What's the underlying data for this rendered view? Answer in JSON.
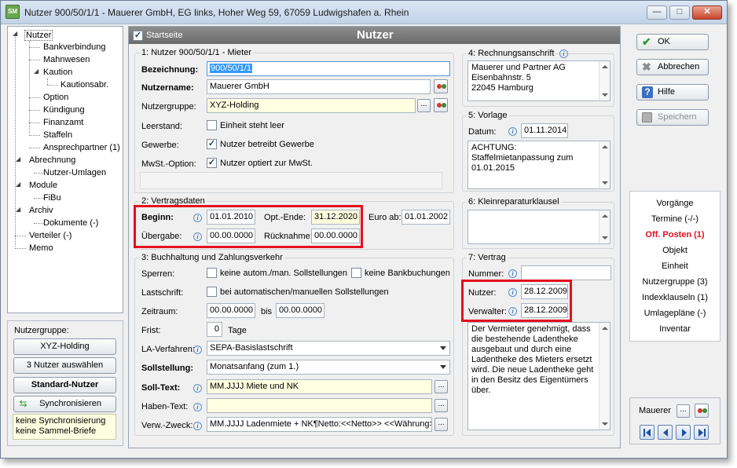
{
  "window": {
    "title": "Nutzer 900/50/1/1 - Mauerer GmbH, EG links, Hoher Weg 59, 67059 Ludwigshafen a. Rhein",
    "icon_text": "SM",
    "minimize": "—",
    "maximize": "□",
    "close": "✕"
  },
  "tree": {
    "items": [
      "Nutzer",
      "Bankverbindung",
      "Mahnwesen",
      "Kaution",
      "Kautionsabr.",
      "Option",
      "Kündigung",
      "Finanzamt",
      "Staffeln",
      "Ansprechpartner (1)",
      "Abrechnung",
      "Nutzer-Umlagen",
      "Module",
      "FiBu",
      "Archiv",
      "Dokumente (-)",
      "Verteiler (-)",
      "Memo"
    ]
  },
  "nutzergruppe_panel": {
    "label": "Nutzergruppe:",
    "group_button": "XYZ-Holding",
    "select_button": "3 Nutzer auswählen",
    "standard_button": "Standard-Nutzer",
    "sync_button": "Synchronisieren",
    "info_line1": "keine Synchronisierung",
    "info_line2": "keine Sammel-Briefe"
  },
  "header": {
    "startseite": "Startseite",
    "title": "Nutzer"
  },
  "section1": {
    "heading": "1: Nutzer 900/50/1/1 - Mieter",
    "bezeichnung_label": "Bezeichnung:",
    "bezeichnung_value": "900/50/1/1",
    "nutzername_label": "Nutzername:",
    "nutzername_value": "Mauerer GmbH",
    "nutzergruppe_label": "Nutzergruppe:",
    "nutzergruppe_value": "XYZ-Holding",
    "leerstand_label": "Leerstand:",
    "leerstand_cb": "Einheit steht leer",
    "gewerbe_label": "Gewerbe:",
    "gewerbe_cb": "Nutzer betreibt Gewerbe",
    "mwst_label": "MwSt.-Option:",
    "mwst_cb": "Nutzer optiert zur MwSt."
  },
  "section2": {
    "heading": "2: Vertragsdaten",
    "beginn_label": "Beginn:",
    "beginn_value": "01.01.2010",
    "optende_label": "Opt.-Ende:",
    "optende_value": "31.12.2020",
    "euroab_label": "Euro ab:",
    "euroab_value": "01.01.2002",
    "uebergabe_label": "Übergabe:",
    "uebergabe_value": "00.00.0000",
    "ruecknahme_label": "Rücknahme:",
    "ruecknahme_value": "00.00.0000"
  },
  "section3": {
    "heading": "3: Buchhaltung und Zahlungsverkehr",
    "sperren_label": "Sperren:",
    "sperren_cb1": "keine autom./man. Sollstellungen",
    "sperren_cb2": "keine Bankbuchungen",
    "lastschrift_label": "Lastschrift:",
    "lastschrift_cb": "bei automatischen/manuellen Sollstellungen",
    "zeitraum_label": "Zeitraum:",
    "zeitraum_from": "00.00.0000",
    "zeitraum_bis": "bis",
    "zeitraum_to": "00.00.0000",
    "frist_label": "Frist:",
    "frist_value": "0",
    "frist_unit": "Tage",
    "laverfahren_label": "LA-Verfahren:",
    "laverfahren_value": "SEPA-Basislastschrift",
    "sollstellung_label": "Sollstellung:",
    "sollstellung_value": "Monatsanfang (zum 1.)",
    "solltext_label": "Soll-Text:",
    "solltext_value": "MM.JJJJ Miete und NK",
    "habentext_label": "Haben-Text:",
    "habentext_value": "",
    "verwzweck_label": "Verw.-Zweck:",
    "verwzweck_value": "MM.JJJJ Ladenmiete + NK¶Netto:<<Netto>> <<Währung>>"
  },
  "section4": {
    "heading": "4: Rechnungsanschrift",
    "line1": "Mauerer und Partner AG",
    "line2": "Eisenbahnstr. 5",
    "line3": "22045 Hamburg"
  },
  "section5": {
    "heading": "5: Vorlage",
    "datum_label": "Datum:",
    "datum_value": "01.11.2014",
    "text1": "ACHTUNG:",
    "text2": "Staffelmietanpassung zum",
    "text3": "01.01.2015"
  },
  "section6": {
    "heading": "6: Kleinreparaturklausel"
  },
  "section7": {
    "heading": "7: Vertrag",
    "nummer_label": "Nummer:",
    "nummer_value": "",
    "nutzer_label": "Nutzer:",
    "nutzer_value": "28.12.2009",
    "verwalter_label": "Verwalter:",
    "verwalter_value": "28.12.2009",
    "text": [
      "Der Vermieter genehmigt, dass",
      "die bestehende Ladentheke",
      "ausgebaut und durch eine",
      "Ladentheke des Mieters ersetzt",
      "wird. Die neue Ladentheke geht",
      "in den Besitz des Eigentümers",
      "über."
    ]
  },
  "actions": {
    "ok": "OK",
    "abbrechen": "Abbrechen",
    "hilfe": "Hilfe",
    "speichern": "Speichern"
  },
  "navlist": {
    "items": [
      "Vorgänge",
      "Termine (-/-)",
      "Off. Posten (1)",
      "Objekt",
      "Einheit",
      "Nutzergruppe (3)",
      "Indexklauseln (1)",
      "Umlagepläne (-)",
      "Inventar"
    ],
    "highlight_color": "#e4101e"
  },
  "navbox": {
    "value": "Mauerer",
    "dots": "..."
  },
  "colors": {
    "highlight_box": "#e4101e",
    "yellow_field": "#ffffe1"
  }
}
